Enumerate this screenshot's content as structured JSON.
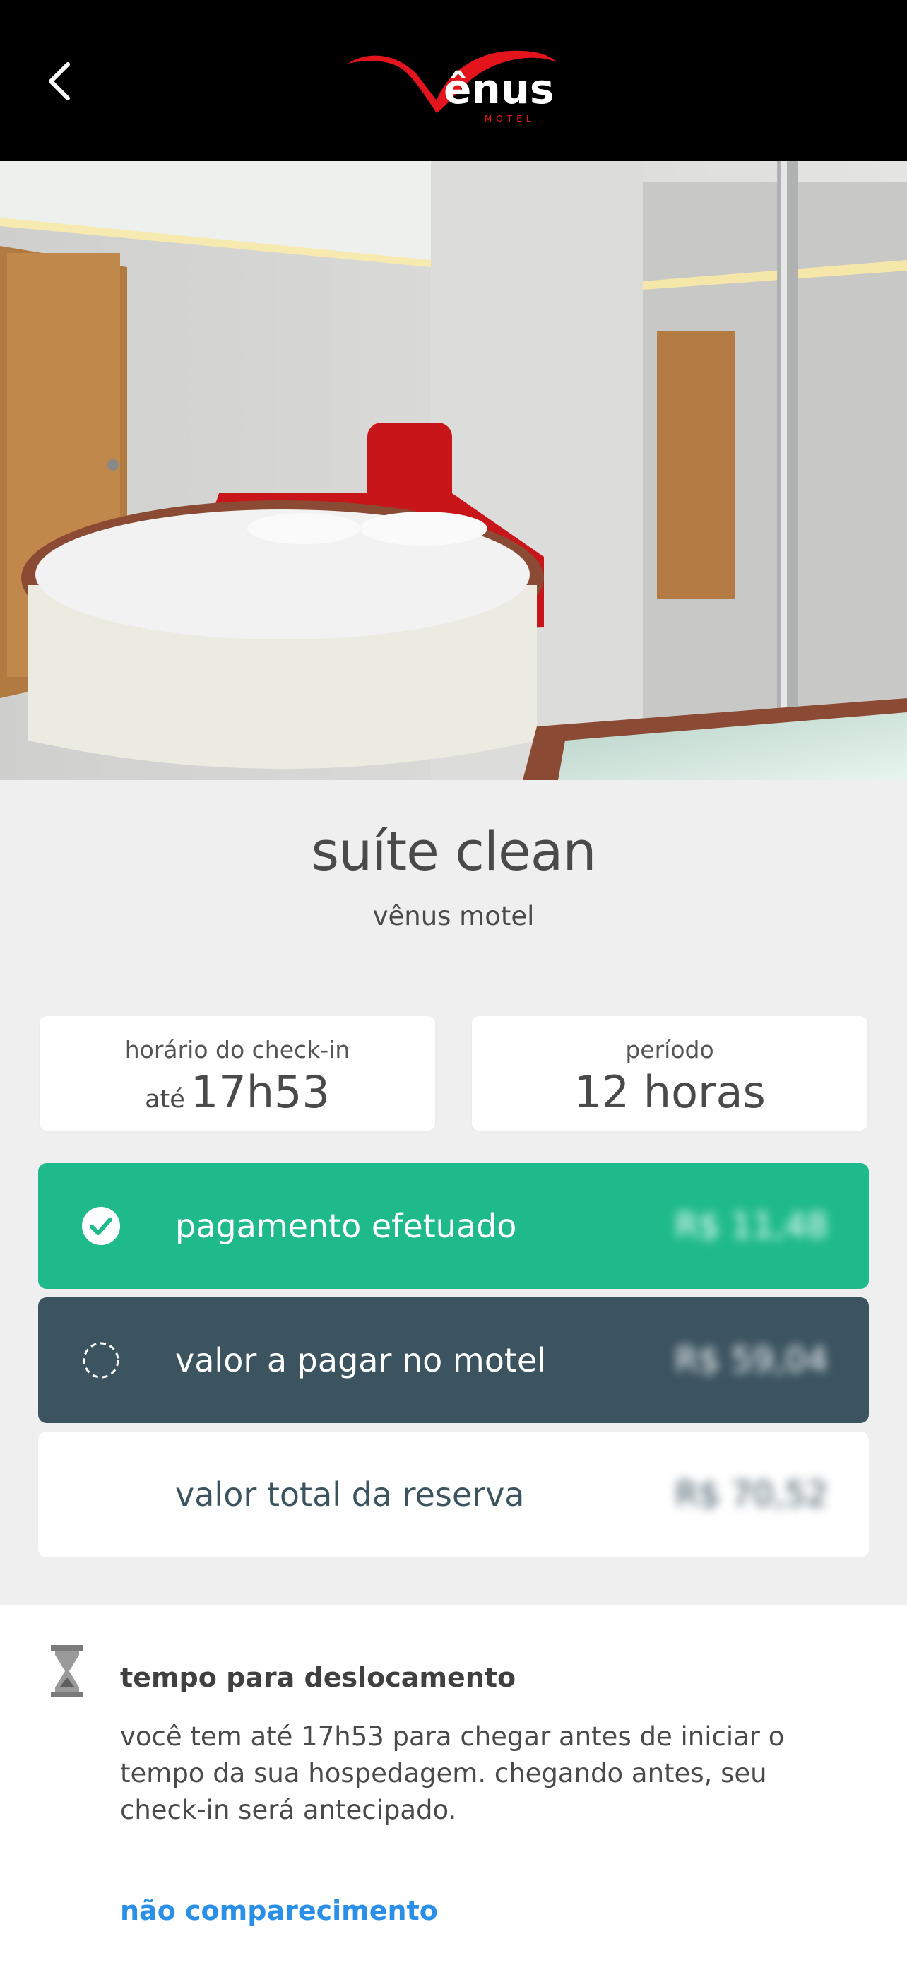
{
  "header": {
    "logo_text": "Vênus",
    "logo_subtext": "MOTEL",
    "back_icon": "chevron-left-icon"
  },
  "suite": {
    "name": "suíte clean",
    "motel": "vênus motel"
  },
  "checkin": {
    "label": "horário do check-in",
    "prefix": "até",
    "time": "17h53"
  },
  "period": {
    "label": "período",
    "value": "12 horas"
  },
  "payment": {
    "paid_label": "pagamento efetuado",
    "paid_amount": "R$ 11,48",
    "due_label": "valor a pagar no motel",
    "due_amount": "R$ 59,04",
    "total_label": "valor total da reserva",
    "total_amount": "R$ 70,52"
  },
  "travel": {
    "icon": "hourglass-icon",
    "title": "tempo para deslocamento",
    "text": "você tem até 17h53 para chegar antes de iniciar o tempo da sua hospedagem. chegando antes, seu check-in será antecipado.",
    "link": "não comparecimento"
  },
  "colors": {
    "paid": "#1fba8b",
    "due": "#3b5460",
    "link": "#2a8fe6",
    "logo_red": "#e3141c"
  }
}
